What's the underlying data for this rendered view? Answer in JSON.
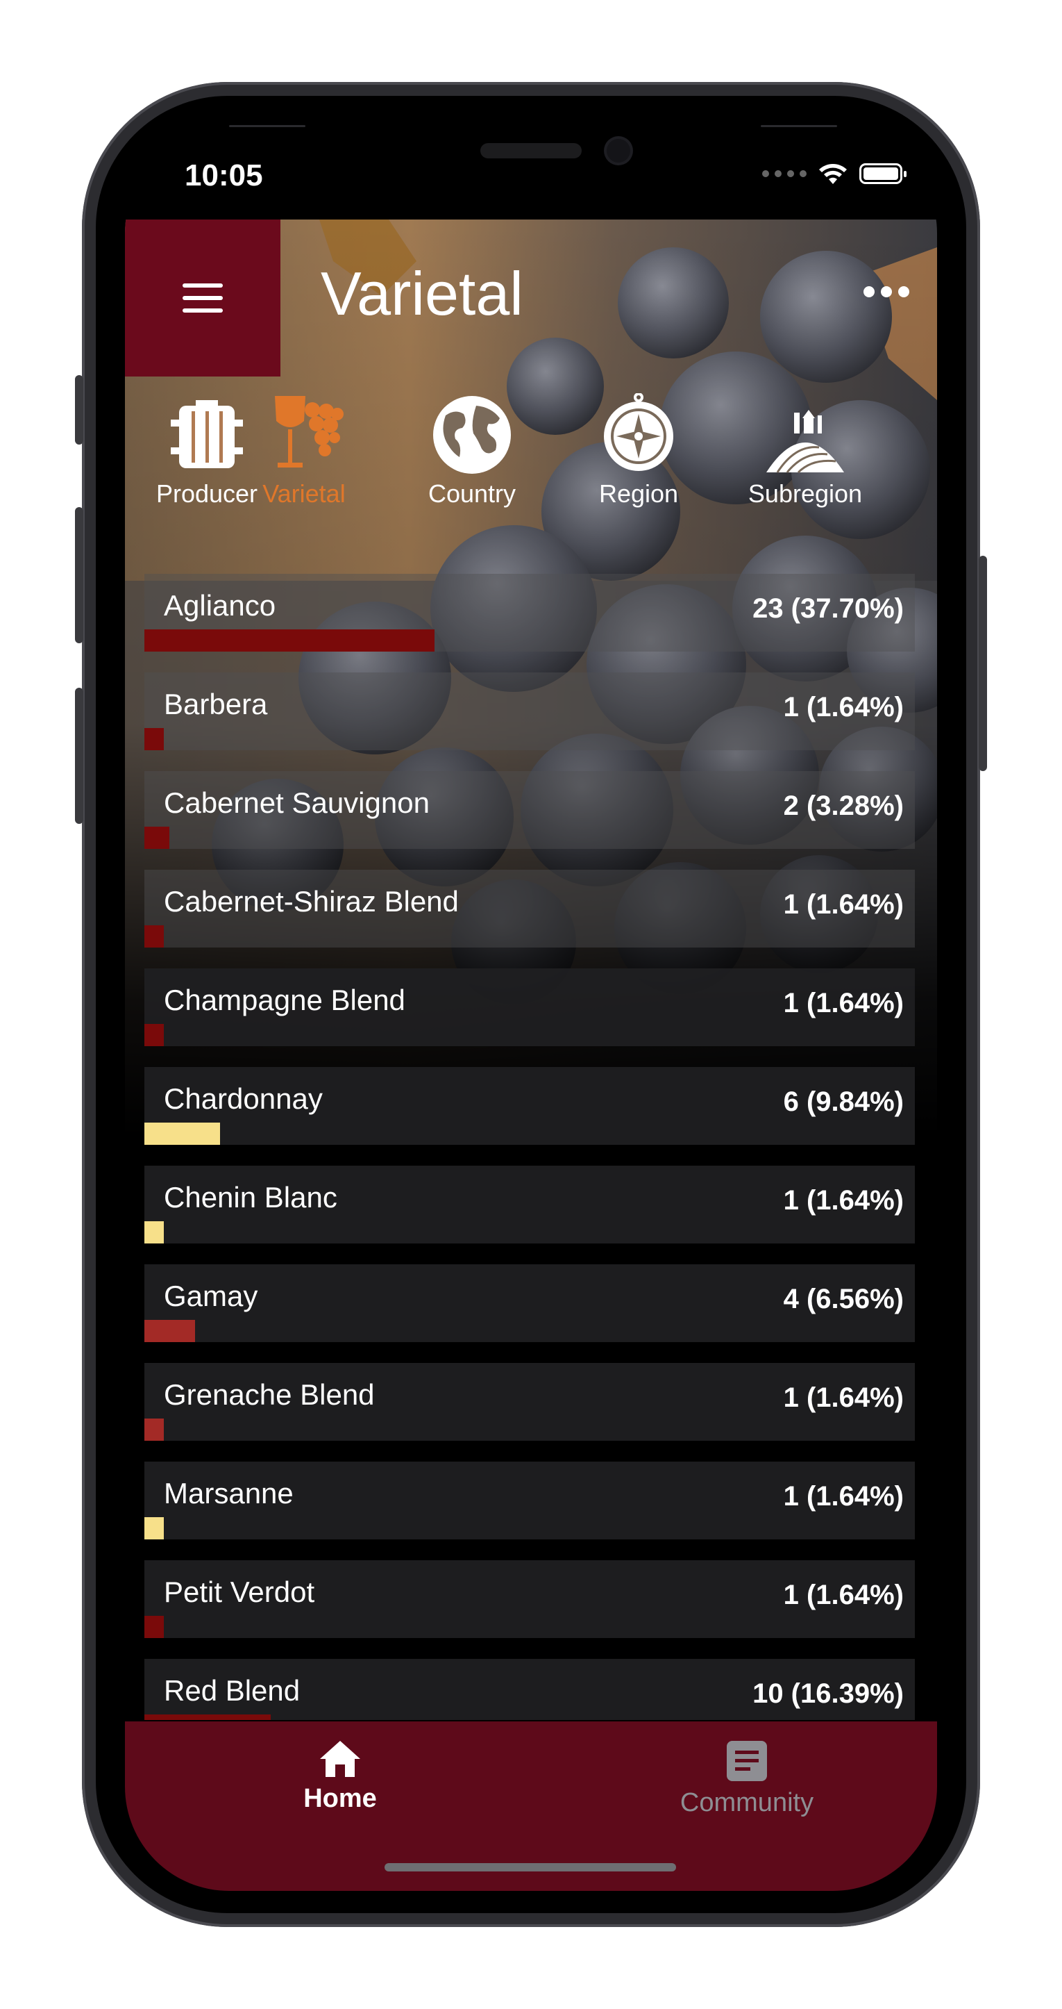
{
  "status": {
    "time": "10:05"
  },
  "header": {
    "title": "Varietal"
  },
  "categories": [
    {
      "label": "Producer",
      "icon": "barrel-icon",
      "active": false
    },
    {
      "label": "Varietal",
      "icon": "grapes-glass-icon",
      "active": true
    },
    {
      "label": "Country",
      "icon": "globe-icon",
      "active": false
    },
    {
      "label": "Region",
      "icon": "compass-icon",
      "active": false
    },
    {
      "label": "Subregion",
      "icon": "vineyard-icon",
      "active": false
    }
  ],
  "colors": {
    "accent": "#e0772a",
    "brand": "#6b0a1c",
    "red": "#7a0a0a",
    "white": "#f7e08a",
    "rose": "#a32a26"
  },
  "varietals": [
    {
      "name": "Aglianco",
      "count": 23,
      "percent": 37.7,
      "display": "23 (37.70%)",
      "color": "#7a0a0a"
    },
    {
      "name": "Barbera",
      "count": 1,
      "percent": 1.64,
      "display": "1 (1.64%)",
      "color": "#7a0a0a"
    },
    {
      "name": "Cabernet Sauvignon",
      "count": 2,
      "percent": 3.28,
      "display": "2 (3.28%)",
      "color": "#7a0a0a"
    },
    {
      "name": "Cabernet-Shiraz Blend",
      "count": 1,
      "percent": 1.64,
      "display": "1 (1.64%)",
      "color": "#7a0a0a"
    },
    {
      "name": "Champagne Blend",
      "count": 1,
      "percent": 1.64,
      "display": "1 (1.64%)",
      "color": "#7a0a0a"
    },
    {
      "name": "Chardonnay",
      "count": 6,
      "percent": 9.84,
      "display": "6 (9.84%)",
      "color": "#f7e08a"
    },
    {
      "name": "Chenin Blanc",
      "count": 1,
      "percent": 1.64,
      "display": "1 (1.64%)",
      "color": "#f7e08a"
    },
    {
      "name": "Gamay",
      "count": 4,
      "percent": 6.56,
      "display": "4 (6.56%)",
      "color": "#a32a26"
    },
    {
      "name": "Grenache Blend",
      "count": 1,
      "percent": 1.64,
      "display": "1 (1.64%)",
      "color": "#a32a26"
    },
    {
      "name": "Marsanne",
      "count": 1,
      "percent": 1.64,
      "display": "1 (1.64%)",
      "color": "#f7e08a"
    },
    {
      "name": "Petit Verdot",
      "count": 1,
      "percent": 1.64,
      "display": "1 (1.64%)",
      "color": "#7a0a0a"
    },
    {
      "name": "Red Blend",
      "count": 10,
      "percent": 16.39,
      "display": "10 (16.39%)",
      "color": "#7a0a0a"
    }
  ],
  "nav": {
    "home": "Home",
    "community": "Community"
  }
}
